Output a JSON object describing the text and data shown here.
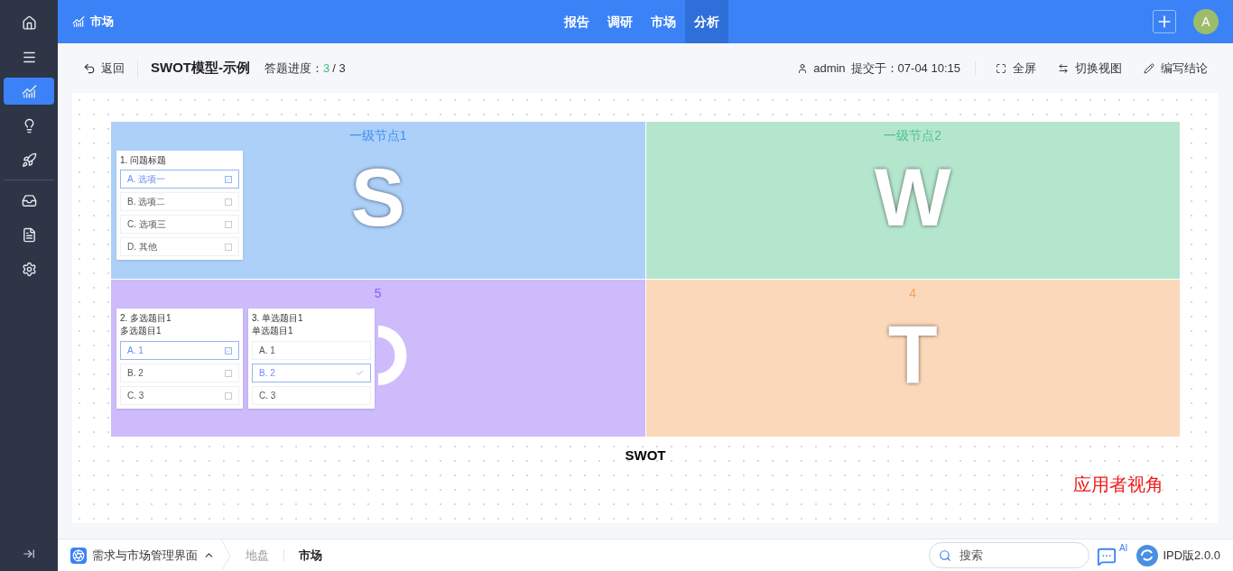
{
  "sidebar": {
    "items": [
      {
        "selected": false
      },
      {
        "selected": false
      },
      {
        "selected": true
      },
      {
        "selected": false
      },
      {
        "selected": false
      },
      {
        "selected": false
      },
      {
        "selected": false
      },
      {
        "selected": false
      }
    ]
  },
  "header": {
    "title": "市场",
    "tabs": [
      {
        "label": "报告",
        "selected": false
      },
      {
        "label": "调研",
        "selected": false
      },
      {
        "label": "市场",
        "selected": false
      },
      {
        "label": "分析",
        "selected": true
      }
    ],
    "avatar": "A"
  },
  "toolbar": {
    "back": "返回",
    "title": "SWOT模型-示例",
    "progress_label": "答题进度：",
    "progress_done": "3",
    "progress_total": "/ 3",
    "user": "admin",
    "submitted": "提交于：07-04 10:15",
    "actions": [
      "全屏",
      "切换视图",
      "编写结论"
    ]
  },
  "swot": {
    "caption": "SWOT",
    "note": "应用者视角",
    "quadrants": [
      {
        "title": "一级节点1",
        "letter": "S",
        "color": "#3b8ff0",
        "cards": [
          {
            "kind": "multiple",
            "title": "1. 问题标题",
            "options": [
              {
                "label": "A. 选项一",
                "selected": true
              },
              {
                "label": "B. 选项二",
                "selected": false
              },
              {
                "label": "C. 选项三",
                "selected": false
              },
              {
                "label": "D. 其他",
                "selected": false
              }
            ]
          }
        ]
      },
      {
        "title": "一级节点2",
        "letter": "W",
        "color": "#4cc38a"
      },
      {
        "title": "5",
        "color": "#8b5cf6",
        "cards": [
          {
            "kind": "multiple",
            "title": "2. 多选题目1",
            "subtitle": "多选题目1",
            "options": [
              {
                "label": "A. 1",
                "selected": true
              },
              {
                "label": "B. 2",
                "selected": false
              },
              {
                "label": "C. 3",
                "selected": false
              }
            ]
          },
          {
            "kind": "single",
            "title": "3. 单选题目1",
            "subtitle": "单选题目1",
            "options": [
              {
                "label": "A. 1",
                "selected": false
              },
              {
                "label": "B. 2",
                "selected": true
              },
              {
                "label": "C. 3",
                "selected": false
              }
            ]
          }
        ]
      },
      {
        "title": "4",
        "letter": "T",
        "color": "#f5a35b"
      }
    ]
  },
  "footer": {
    "app": "需求与市场管理界面",
    "breadcrumbs": [
      {
        "label": "地盘",
        "selected": false
      },
      {
        "label": "市场",
        "selected": true
      }
    ],
    "search": {
      "placeholder": "搜索"
    },
    "ai": "AI",
    "version": "IPD版2.0.0"
  }
}
